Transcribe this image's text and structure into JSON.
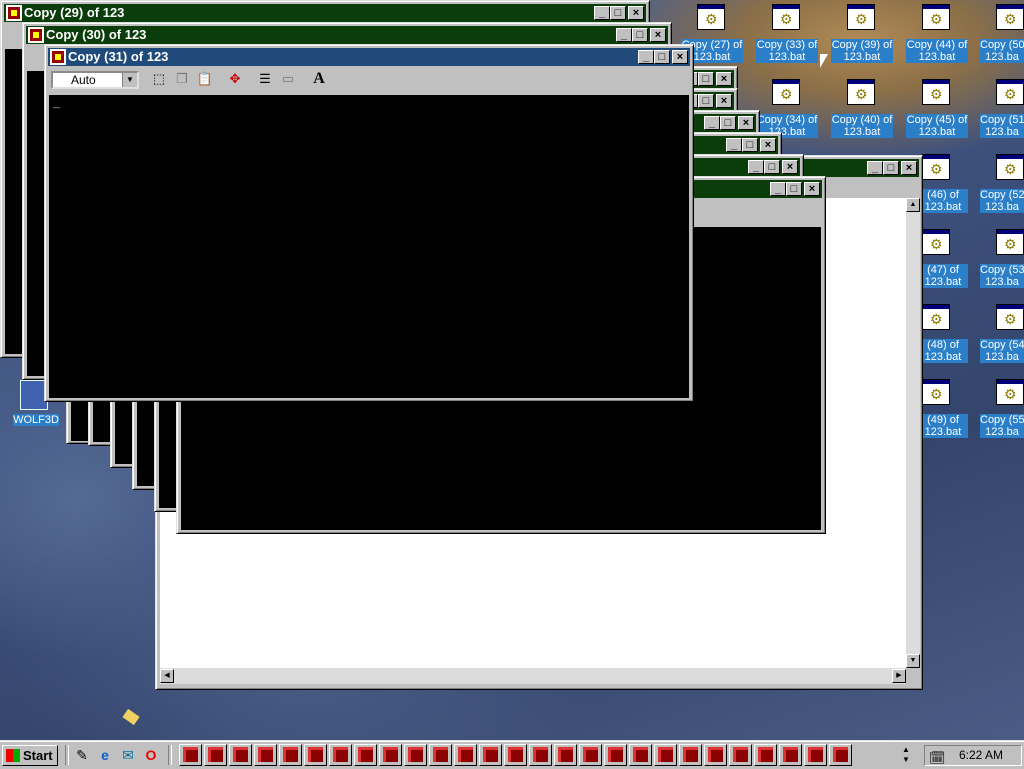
{
  "windows": [
    {
      "title": "Copy (29) of 123"
    },
    {
      "title": "Copy (30) of 123"
    },
    {
      "title": "Copy (31) of 123"
    }
  ],
  "window_buttons": {
    "minimize": "_",
    "maximize": "□",
    "close": "×"
  },
  "toolbar": {
    "font_size": "Auto",
    "font_button": "A"
  },
  "cursor_text": "_",
  "desktop_icons": [
    {
      "label": "Copy (27) of\n123.bat"
    },
    {
      "label": "Copy (33) of\n123.bat"
    },
    {
      "label": "Copy (39) of\n123.bat"
    },
    {
      "label": "Copy (44) of\n123.bat"
    },
    {
      "label": "Copy (50\n123.ba"
    },
    {
      "label": "Copy (34) of\n123.bat"
    },
    {
      "label": "Copy (40) of\n123.bat"
    },
    {
      "label": "Copy (45) of\n123.bat"
    },
    {
      "label": "Copy (51\n123.ba"
    },
    {
      "label": "(46) of\n123.bat"
    },
    {
      "label": "Copy (52\n123.ba"
    },
    {
      "label": "(47) of\n123.bat"
    },
    {
      "label": "Copy (53\n123.ba"
    },
    {
      "label": "(48) of\n123.bat"
    },
    {
      "label": "Copy (54\n123.ba"
    },
    {
      "label": "(49) of\n123.bat"
    },
    {
      "label": "Copy (55\n123.ba"
    },
    {
      "label": "WOLF3D"
    }
  ],
  "taskbar": {
    "start_label": "Start",
    "clock": "6:22 AM",
    "task_count": 27
  }
}
